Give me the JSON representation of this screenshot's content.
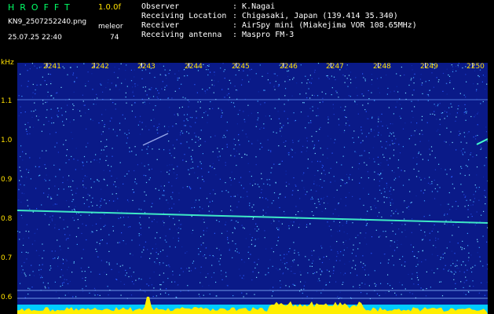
{
  "header": {
    "logo": "HROFFT",
    "version": "1.0.0f",
    "filename": "KN9_2507252240.png",
    "type_label": "meleor",
    "datetime": "25.07.25 22:40",
    "count": "74",
    "fields": [
      {
        "label": "Observer",
        "value": ": K.Nagai"
      },
      {
        "label": "Receiving Location",
        "value": ": Chigasaki, Japan (139.414 35.340)"
      },
      {
        "label": "Receiver",
        "value": ": AirSpy mini (Miakejima VOR 108.65MHz)"
      },
      {
        "label": "Receiving antenna",
        "value": ": Maspro FM-3"
      }
    ]
  },
  "plot": {
    "unit": "kHz",
    "y_ticks": [
      "1.1",
      "1.0",
      "0.9",
      "0.8",
      "0.7",
      "0.6"
    ],
    "x_ticks": [
      "2241",
      "2242",
      "2243",
      "2244",
      "2245",
      "2246",
      "2247",
      "2248",
      "2249",
      "2250"
    ],
    "colors": {
      "background": "#0a1a88",
      "axis_text": "#ffe000",
      "trace": "#44ffcc",
      "baseline": "#ffee00",
      "bottom_band": "#00ccff"
    }
  }
}
